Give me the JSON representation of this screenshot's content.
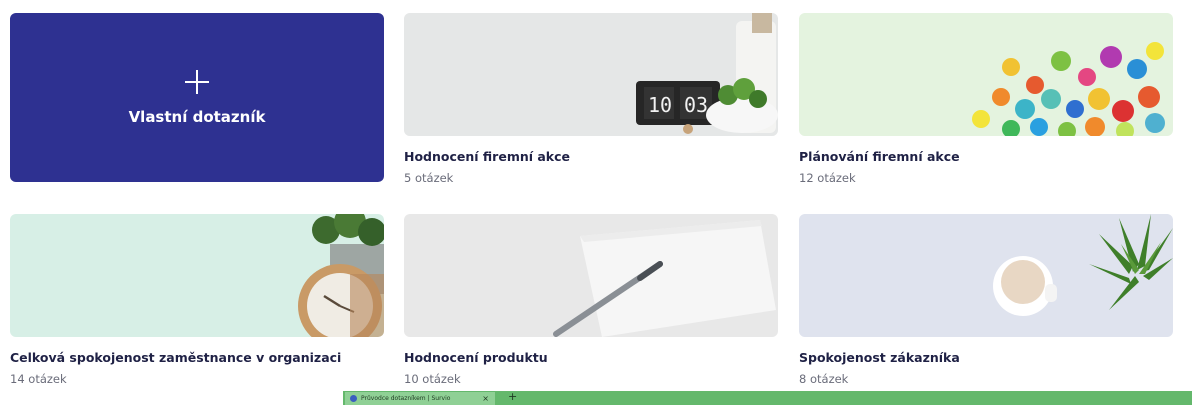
{
  "custom_card": {
    "label": "Vlastní dotazník"
  },
  "templates": [
    {
      "title": "Hodnocení firemní akce",
      "count": "5 otázek",
      "clock_digits": [
        "10",
        "03"
      ]
    },
    {
      "title": "Plánování firemní akce",
      "count": "12 otázek"
    },
    {
      "title": "Celková spokojenost zaměstnance v organizaci",
      "count": "14 otázek"
    },
    {
      "title": "Hodnocení produktu",
      "count": "10 otázek"
    },
    {
      "title": "Spokojenost zákazníka",
      "count": "8 otázek"
    }
  ],
  "taskbar": {
    "tab_title": "Průvodce dotazníkem | Survio",
    "close": "×",
    "new_tab": "+"
  },
  "colors": {
    "custom_card_bg": "#2e3191",
    "title_text": "#1f2145",
    "count_text": "#6a6c7a",
    "taskbar_bg": "#64b86c"
  },
  "icons": [
    "plus-icon",
    "browser-favicon-icon",
    "close-icon",
    "new-tab-icon"
  ]
}
